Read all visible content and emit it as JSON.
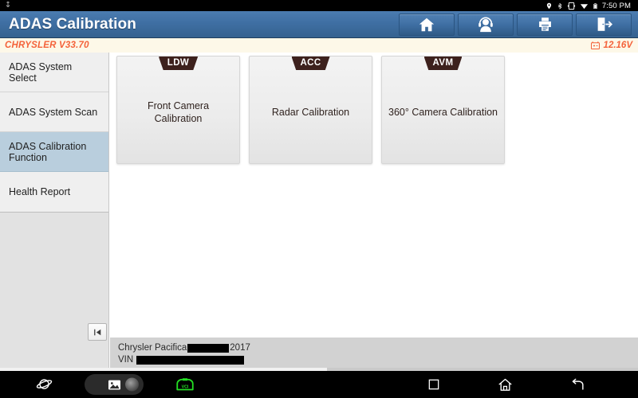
{
  "status_bar": {
    "icons": [
      "location-pin-icon",
      "bluetooth-icon",
      "screen-rotation-icon",
      "wifi-icon",
      "battery-icon"
    ],
    "time": "7:50 PM"
  },
  "header": {
    "title": "ADAS Calibration",
    "buttons": [
      {
        "name": "home-button",
        "icon": "home-icon",
        "label": "Home"
      },
      {
        "name": "support-button",
        "icon": "headset-person-icon",
        "label": "Support"
      },
      {
        "name": "print-button",
        "icon": "printer-icon",
        "label": "Print"
      },
      {
        "name": "exit-button",
        "icon": "exit-door-icon",
        "label": "Exit"
      }
    ]
  },
  "version_bar": {
    "vehicle_version": "CHRYSLER V33.70",
    "battery_icon": "car-battery-icon",
    "voltage": "12.16V",
    "accent_color": "#f4623a",
    "background_color": "#fdf8e8"
  },
  "sidebar": {
    "items": [
      {
        "label": "ADAS System Select",
        "active": false
      },
      {
        "label": "ADAS System Scan",
        "active": false
      },
      {
        "label": "ADAS Calibration Function",
        "active": true
      },
      {
        "label": "Health Report",
        "active": false
      }
    ],
    "active_color": "#b9cedd"
  },
  "content": {
    "cards": [
      {
        "badge": "LDW",
        "title": "Front Camera Calibration"
      },
      {
        "badge": "ACC",
        "title": "Radar Calibration"
      },
      {
        "badge": "AVM",
        "title": "360° Camera Calibration"
      }
    ],
    "badge_color": "#3d211d"
  },
  "collapse_button": {
    "name": "collapse-panel-button",
    "icon": "collapse-left-icon"
  },
  "vehicle_info": {
    "line1_prefix": "Chrysler Pacifica",
    "line1_suffix": "2017",
    "line2_prefix": "VIN",
    "redacted": true
  },
  "nav_bar": {
    "items": [
      {
        "name": "browser-button",
        "icon": "planet-browser-icon"
      },
      {
        "name": "screenshot-button",
        "icon": "image-icon"
      },
      {
        "name": "vci-status-button",
        "icon": "vci-connector-icon",
        "color": "#24e024"
      },
      {
        "name": "recents-button",
        "icon": "square-recents-icon"
      },
      {
        "name": "home-nav-button",
        "icon": "home-outline-icon"
      },
      {
        "name": "back-button",
        "icon": "back-arrow-icon"
      }
    ]
  }
}
